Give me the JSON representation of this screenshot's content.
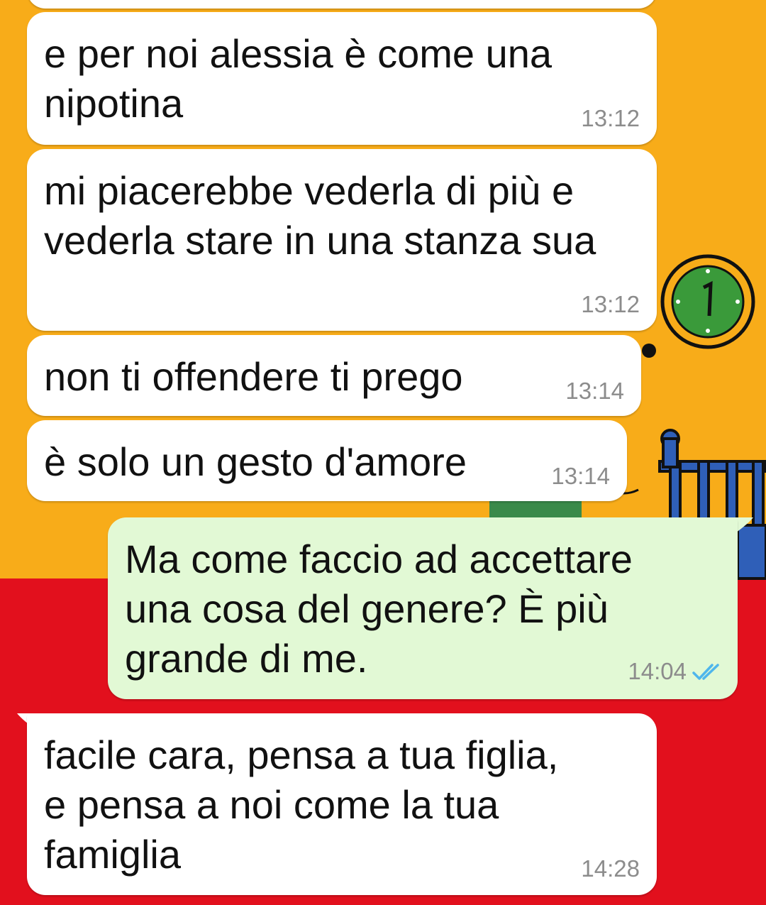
{
  "chat": {
    "messages": [
      {
        "direction": "in",
        "text": "e per noi alessia è come una\nnipotina",
        "time": "13:12"
      },
      {
        "direction": "in",
        "text": "mi piacerebbe vederla di più e\nvederla stare in una stanza sua",
        "time": "13:12"
      },
      {
        "direction": "in",
        "text": "non ti offendere ti prego",
        "time": "13:14"
      },
      {
        "direction": "in",
        "text": "è solo un gesto d'amore",
        "time": "13:14"
      },
      {
        "direction": "out",
        "text": "Ma come faccio ad accettare\nuna cosa del genere? È più\ngrande di me.",
        "time": "14:04",
        "status": "read"
      },
      {
        "direction": "in",
        "text": "facile cara, pensa a tua figlia,\ne pensa a noi come la tua\nfamiglia",
        "time": "14:28"
      }
    ]
  },
  "colors": {
    "incoming_bubble": "#ffffff",
    "outgoing_bubble": "#e2f9d5",
    "read_check": "#4fb6ec",
    "wallpaper_top": "#f8ac19",
    "wallpaper_bottom": "#e2101d"
  },
  "icons": {
    "read_receipt": "double-check-icon"
  }
}
